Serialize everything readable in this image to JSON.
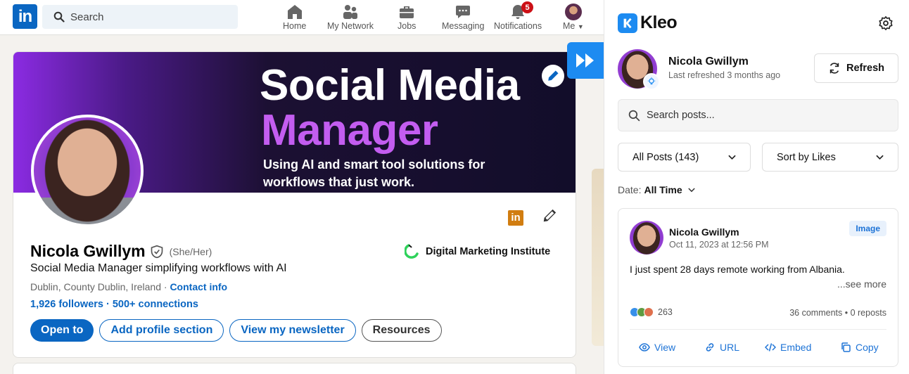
{
  "nav": {
    "logo": "in",
    "search_placeholder": "Search",
    "items": [
      {
        "label": "Home"
      },
      {
        "label": "My Network"
      },
      {
        "label": "Jobs"
      },
      {
        "label": "Messaging"
      },
      {
        "label": "Notifications",
        "badge": "5"
      },
      {
        "label": "Me"
      }
    ]
  },
  "profile": {
    "banner": {
      "line1": "Social Media",
      "line2": "Manager",
      "sub1": "Using AI and smart tool solutions for",
      "sub2": "workflows that just work."
    },
    "li_badge": "in",
    "name": "Nicola Gwillym",
    "pronouns": "(She/Her)",
    "headline": "Social Media Manager simplifying workflows with AI",
    "location": "Dublin, County Dublin, Ireland ·",
    "contact_info": "Contact info",
    "followers": "1,926 followers",
    "connections": "· 500+ connections",
    "company": "Digital Marketing Institute",
    "buttons": {
      "open_to": "Open to",
      "add_section": "Add profile section",
      "newsletter": "View my newsletter",
      "resources": "Resources"
    }
  },
  "kleo": {
    "brand": "Kleo",
    "user_name": "Nicola Gwillym",
    "last_refreshed": "Last refreshed 3 months ago",
    "refresh_label": "Refresh",
    "search_placeholder": "Search posts...",
    "filter_posts": "All Posts (143)",
    "sort": "Sort by Likes",
    "date_label": "Date:",
    "date_value": "All Time",
    "post": {
      "author": "Nicola Gwillym",
      "date": "Oct 11, 2023 at 12:56 PM",
      "type": "Image",
      "text": "I just spent 28 days remote working from Albania.",
      "see_more": "...see more",
      "reaction_count": "263",
      "stats": "36 comments • 0 reposts",
      "actions": {
        "view": "View",
        "url": "URL",
        "embed": "Embed",
        "copy": "Copy"
      }
    }
  },
  "colors": {
    "linkedin_blue": "#0a66c2",
    "kleo_blue": "#1d8bf1",
    "banner_accent": "#c35df0"
  }
}
